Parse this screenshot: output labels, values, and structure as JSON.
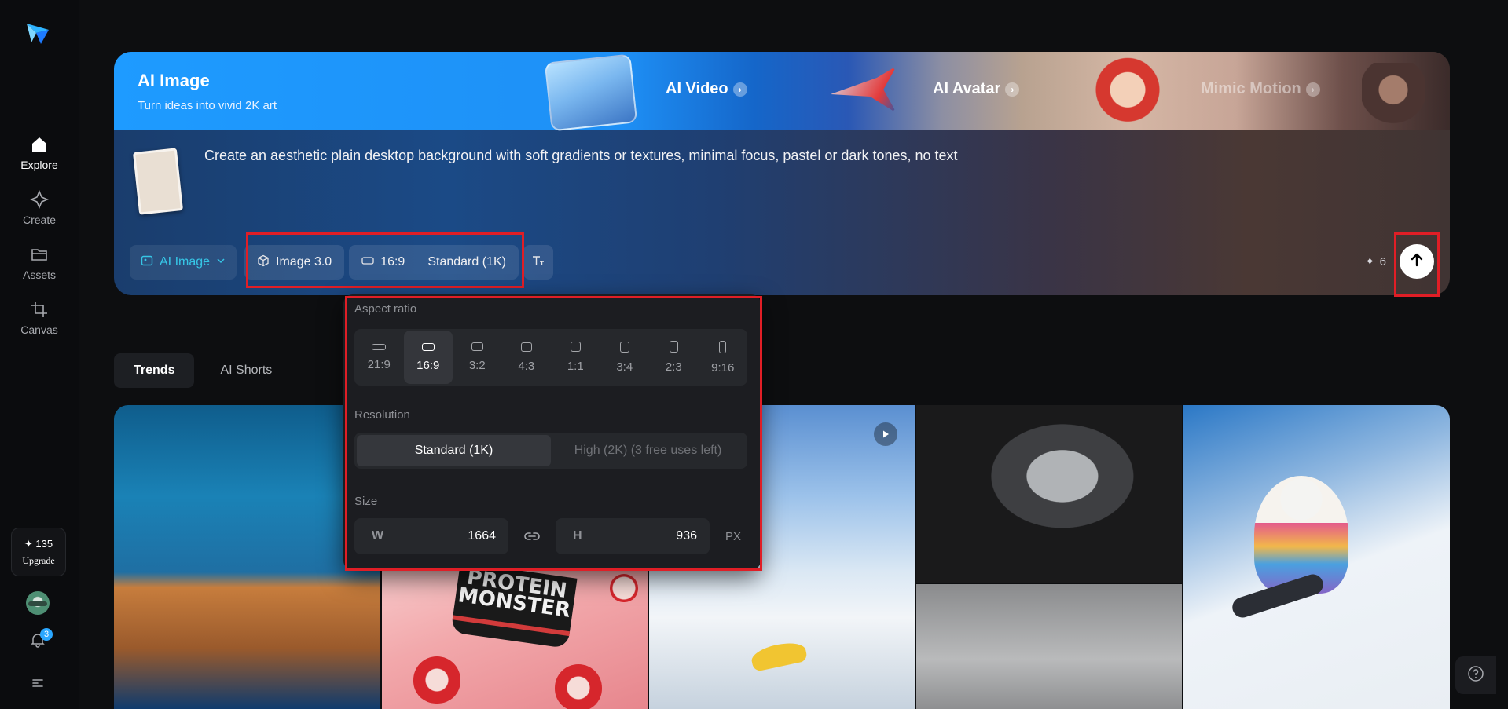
{
  "sidebar": {
    "items": [
      {
        "label": "Explore"
      },
      {
        "label": "Create"
      },
      {
        "label": "Assets"
      },
      {
        "label": "Canvas"
      }
    ],
    "upgrade": {
      "credits": "✦ 135",
      "label": "Upgrade"
    },
    "notifications_count": "3"
  },
  "hero": {
    "title": "AI Image",
    "subtitle": "Turn ideas into vivid 2K art",
    "tabs": [
      {
        "label": "AI Video"
      },
      {
        "label": "AI Avatar"
      },
      {
        "label": "Mimic Motion"
      }
    ],
    "prompt": "Create an aesthetic plain desktop background with soft gradients or textures, minimal focus, pastel or dark tones, no text",
    "toolbar": {
      "mode": "AI Image",
      "model": "Image 3.0",
      "ratio": "16:9",
      "resolution": "Standard (1K)",
      "credits": "6"
    }
  },
  "tabs": [
    {
      "label": "Trends"
    },
    {
      "label": "AI Shorts"
    }
  ],
  "gallery": {
    "product_text": "PROTEIN MONSTER"
  },
  "popover": {
    "aspect_label": "Aspect ratio",
    "ratios": [
      "21:9",
      "16:9",
      "3:2",
      "4:3",
      "1:1",
      "3:4",
      "2:3",
      "9:16"
    ],
    "selected_ratio": "16:9",
    "resolution_label": "Resolution",
    "resolution_options": [
      "Standard (1K)",
      "High (2K)  (3 free uses left)"
    ],
    "size_label": "Size",
    "width_key": "W",
    "width_value": "1664",
    "height_key": "H",
    "height_value": "936",
    "unit": "PX"
  },
  "colors": {
    "accent": "#36c6e6",
    "highlight": "#e01e26",
    "background": "#0d0e10"
  }
}
